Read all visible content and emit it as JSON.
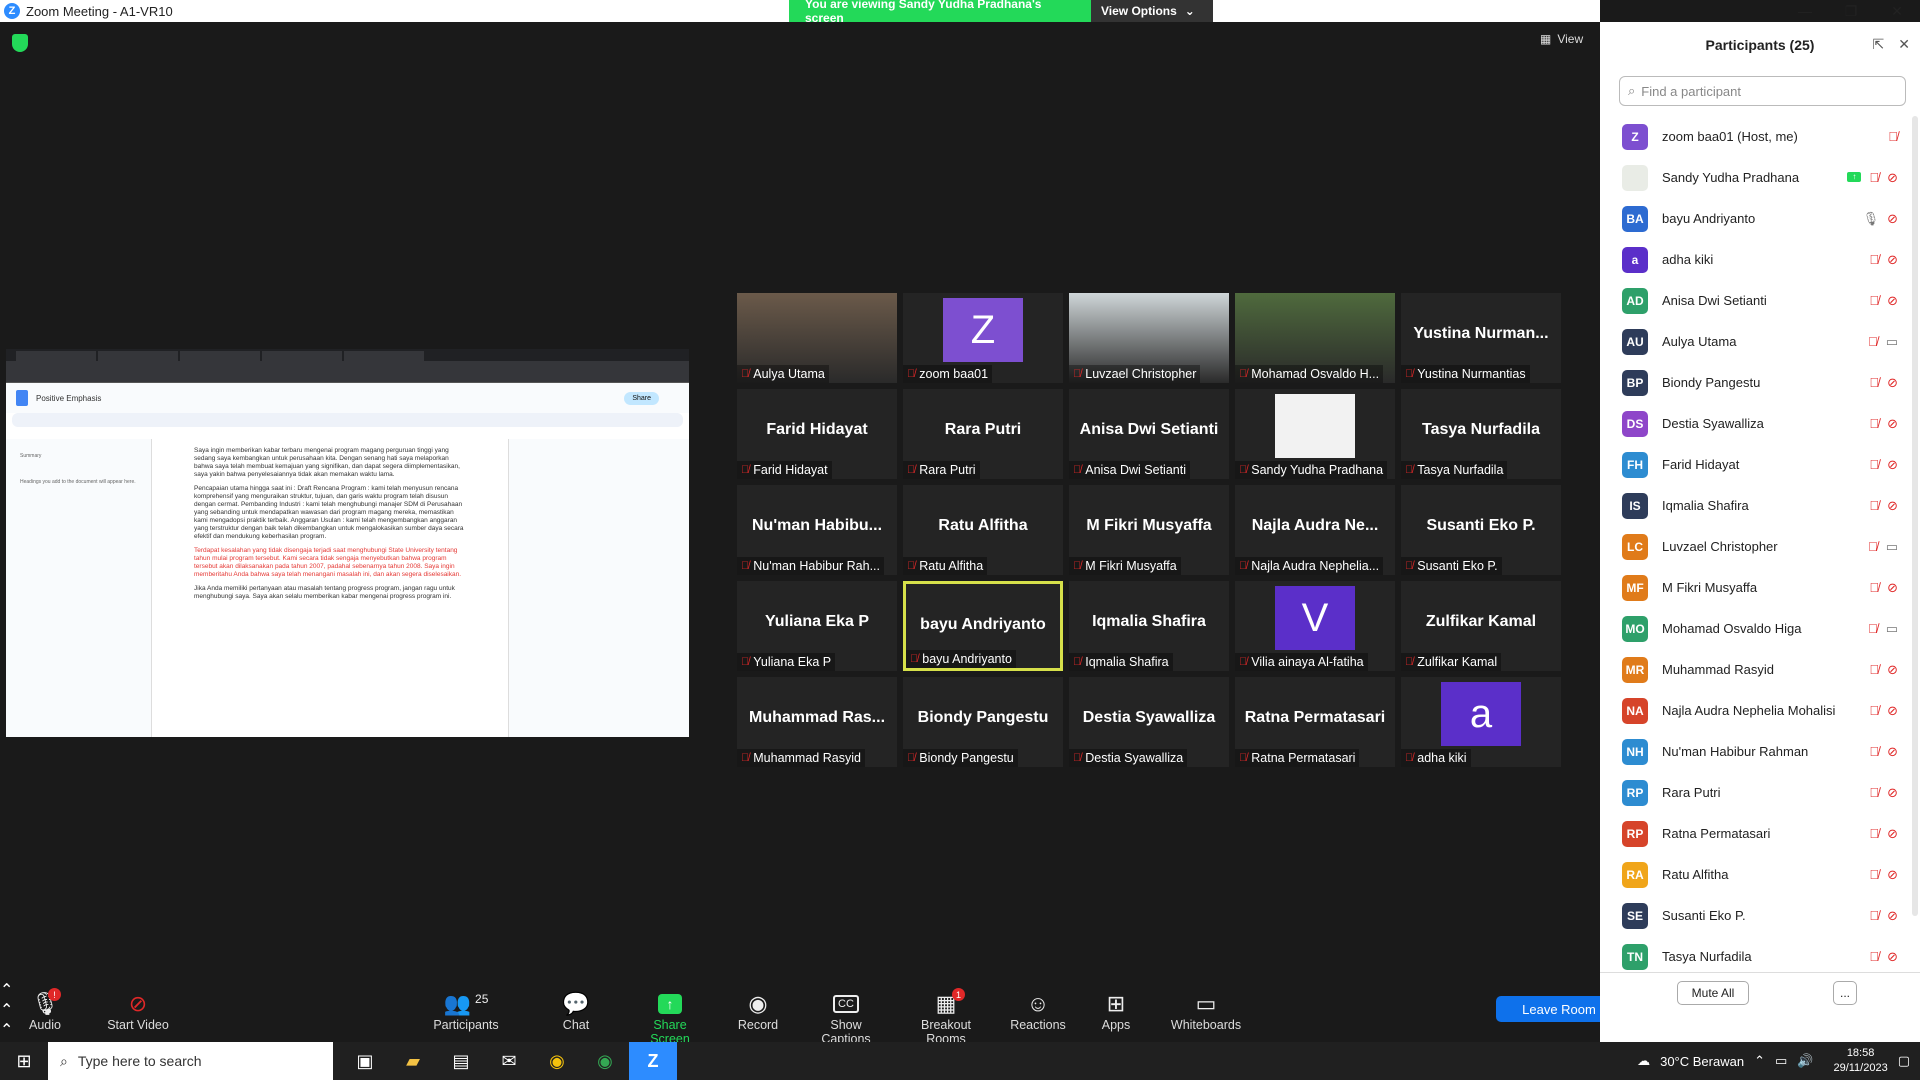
{
  "window": {
    "title": "Zoom Meeting - A1-VR10",
    "controls": [
      "minimize",
      "restore",
      "close"
    ]
  },
  "banner": {
    "message": "You are viewing Sandy Yudha Pradhana's screen",
    "view_options": "View Options"
  },
  "view_button": "View",
  "shared_screen": {
    "doc_title": "Positive Emphasis",
    "share_label": "Share",
    "outline_title": "Summary",
    "outline_note": "Headings you add to the document will appear here.",
    "paragraphs": [
      "Saya ingin memberikan kabar terbaru mengenai program magang perguruan tinggi yang sedang saya kembangkan untuk perusahaan kita. Dengan senang hati saya melaporkan bahwa saya telah membuat kemajuan yang signifikan, dan dapat segera diimplementasikan, saya yakin bahwa penyelesaiannya tidak akan memakan waktu lama.",
      "Pencapaian utama hingga saat ini : Draft Rencana Program : kami telah menyusun rencana komprehensif yang menguraikan struktur, tujuan, dan garis waktu program telah disusun dengan cermat. Pembanding Industri : kami telah menghubungi manajer SDM di Perusahaan yang sebanding untuk mendapatkan wawasan dari program magang mereka, memastikan kami mengadopsi praktik terbaik. Anggaran Usulan : kami telah mengembangkan anggaran yang terstruktur dengan baik telah dikembangkan untuk mengalokasikan sumber daya secara efektif dan mendukung keberhasilan program.",
      "Terdapat kesalahan yang tidak disengaja terjadi saat menghubungi State University tentang tahun mulai program tersebut. Kami secara tidak sengaja menyebutkan bahwa program tersebut akan dilaksanakan pada tahun 2007, padahal sebenarnya tahun 2008. Saya ingin memberitahu Anda bahwa saya telah menangani masalah ini, dan akan segera diselesaikan.",
      "Jika Anda memiliki pertanyaan atau masalah tentang progress program, jangan ragu untuk menghubungi saya. Saya akan selalu memberikan kabar mengenai progress program ini."
    ]
  },
  "tiles": [
    {
      "display": "",
      "label": "Aulya Utama",
      "kind": "photo",
      "color": "#6b5a4a"
    },
    {
      "display": "Z",
      "label": "zoom baa01",
      "kind": "avatar",
      "color": "#7d4fd0"
    },
    {
      "display": "",
      "label": "Luvzael Christopher",
      "kind": "photo",
      "color": "#cfd6d8"
    },
    {
      "display": "",
      "label": "Mohamad Osvaldo H...",
      "kind": "photo",
      "color": "#4f6a3d"
    },
    {
      "display": "Yustina  Nurman...",
      "label": "Yustina Nurmantias",
      "kind": "name"
    },
    {
      "display": "Farid Hidayat",
      "label": "Farid Hidayat",
      "kind": "name"
    },
    {
      "display": "Rara Putri",
      "label": "Rara Putri",
      "kind": "name"
    },
    {
      "display": "Anisa Dwi Setianti",
      "label": "Anisa Dwi Setianti",
      "kind": "name"
    },
    {
      "display": "",
      "label": "Sandy Yudha Pradhana",
      "kind": "bear",
      "color": "#f2f2f2"
    },
    {
      "display": "Tasya Nurfadila",
      "label": "Tasya Nurfadila",
      "kind": "name"
    },
    {
      "display": "Nu'man  Habibu...",
      "label": "Nu'man Habibur Rah...",
      "kind": "name"
    },
    {
      "display": "Ratu Alfitha",
      "label": "Ratu Alfitha",
      "kind": "name"
    },
    {
      "display": "M Fikri Musyaffa",
      "label": "M Fikri Musyaffa",
      "kind": "name"
    },
    {
      "display": "Najla Audra Ne...",
      "label": "Najla Audra Nephelia...",
      "kind": "name"
    },
    {
      "display": "Susanti Eko P.",
      "label": "Susanti Eko P.",
      "kind": "name"
    },
    {
      "display": "Yuliana Eka P",
      "label": "Yuliana Eka P",
      "kind": "name"
    },
    {
      "display": "bayu Andriyanto",
      "label": "bayu Andriyanto",
      "kind": "name",
      "active": true
    },
    {
      "display": "Iqmalia Shafira",
      "label": "Iqmalia Shafira",
      "kind": "name"
    },
    {
      "display": "V",
      "label": "Vilia ainaya Al-fatiha",
      "kind": "avatar",
      "color": "#5b2fc9"
    },
    {
      "display": "Zulfikar Kamal",
      "label": "Zulfikar Kamal",
      "kind": "name"
    },
    {
      "display": "Muhammad  Ras...",
      "label": "Muhammad Rasyid",
      "kind": "name"
    },
    {
      "display": "Biondy Pangestu",
      "label": "Biondy Pangestu",
      "kind": "name"
    },
    {
      "display": "Destia Syawalliza",
      "label": "Destia Syawalliza",
      "kind": "name"
    },
    {
      "display": "Ratna Permatasari",
      "label": "Ratna Permatasari",
      "kind": "name"
    },
    {
      "display": "a",
      "label": "adha kiki",
      "kind": "avatar",
      "color": "#5b2fc9"
    }
  ],
  "toolbar": {
    "audio": "Audio",
    "start_video": "Start Video",
    "participants": "Participants",
    "participants_count": "25",
    "chat": "Chat",
    "share_screen": "Share Screen",
    "record": "Record",
    "show_captions": "Show Captions",
    "breakout_rooms": "Breakout Rooms",
    "breakout_badge": "1",
    "reactions": "Reactions",
    "apps": "Apps",
    "whiteboards": "Whiteboards",
    "leave_room": "Leave Room",
    "audio_badge": "!"
  },
  "panel": {
    "title": "Participants (25)",
    "search_placeholder": "Find a participant",
    "mute_all": "Mute All",
    "more": "...",
    "participants": [
      {
        "initials": "Z",
        "name": "zoom baa01 (Host, me)",
        "color": "#7d4fd0",
        "mic": "muted",
        "video": "none"
      },
      {
        "initials": "",
        "name": "Sandy Yudha Pradhana",
        "color": "#e9ece6",
        "mic": "muted",
        "video": "off",
        "sharing": true
      },
      {
        "initials": "BA",
        "name": "bayu Andriyanto",
        "color": "#2d6bd1",
        "mic": "on",
        "video": "off"
      },
      {
        "initials": "a",
        "name": "adha kiki",
        "color": "#5b2fc9",
        "mic": "muted",
        "video": "off"
      },
      {
        "initials": "AD",
        "name": "Anisa Dwi Setianti",
        "color": "#2ea06a",
        "mic": "muted",
        "video": "off"
      },
      {
        "initials": "AU",
        "name": "Aulya Utama",
        "color": "#2e3c5a",
        "mic": "muted",
        "video": "on"
      },
      {
        "initials": "BP",
        "name": "Biondy Pangestu",
        "color": "#2e3c5a",
        "mic": "muted",
        "video": "off"
      },
      {
        "initials": "DS",
        "name": "Destia Syawalliza",
        "color": "#8e46c9",
        "mic": "muted",
        "video": "off"
      },
      {
        "initials": "FH",
        "name": "Farid Hidayat",
        "color": "#2d8cd1",
        "mic": "muted",
        "video": "off"
      },
      {
        "initials": "IS",
        "name": "Iqmalia Shafira",
        "color": "#2e3c5a",
        "mic": "muted",
        "video": "off"
      },
      {
        "initials": "LC",
        "name": "Luvzael Christopher",
        "color": "#e07b1a",
        "mic": "muted",
        "video": "on"
      },
      {
        "initials": "MF",
        "name": "M Fikri Musyaffa",
        "color": "#e07b1a",
        "mic": "muted",
        "video": "off"
      },
      {
        "initials": "MO",
        "name": "Mohamad Osvaldo Higa",
        "color": "#2ea06a",
        "mic": "muted",
        "video": "on"
      },
      {
        "initials": "MR",
        "name": "Muhammad Rasyid",
        "color": "#e07b1a",
        "mic": "muted",
        "video": "off"
      },
      {
        "initials": "NA",
        "name": "Najla Audra Nephelia Mohalisi",
        "color": "#d6442a",
        "mic": "muted",
        "video": "off"
      },
      {
        "initials": "NH",
        "name": "Nu'man Habibur Rahman",
        "color": "#2d8cd1",
        "mic": "muted",
        "video": "off"
      },
      {
        "initials": "RP",
        "name": "Rara Putri",
        "color": "#2d8cd1",
        "mic": "muted",
        "video": "off"
      },
      {
        "initials": "RP",
        "name": "Ratna Permatasari",
        "color": "#d6442a",
        "mic": "muted",
        "video": "off"
      },
      {
        "initials": "RA",
        "name": "Ratu Alfitha",
        "color": "#f0a51a",
        "mic": "muted",
        "video": "off"
      },
      {
        "initials": "SE",
        "name": "Susanti Eko P.",
        "color": "#2e3c5a",
        "mic": "muted",
        "video": "off"
      },
      {
        "initials": "TN",
        "name": "Tasya Nurfadila",
        "color": "#2ea06a",
        "mic": "muted",
        "video": "off"
      }
    ]
  },
  "taskbar": {
    "search_placeholder": "Type here to search",
    "weather": "30°C  Berawan",
    "time": "18:58",
    "date": "29/11/2023"
  }
}
